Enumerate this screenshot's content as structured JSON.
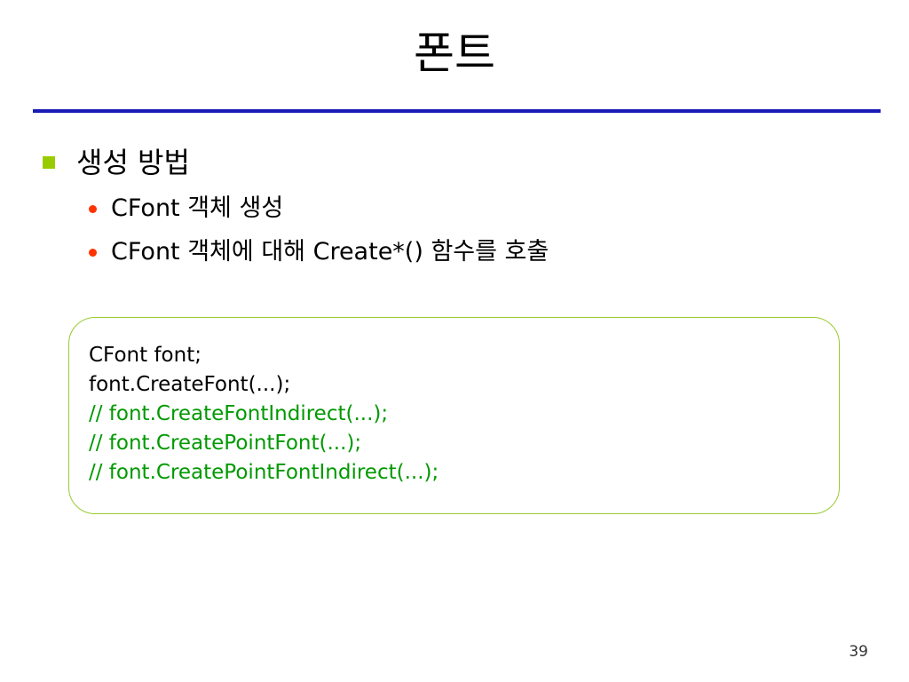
{
  "title": "폰트",
  "bullet_level1": {
    "text": "생성 방법"
  },
  "bullets_level2": [
    {
      "text": "CFont 객체 생성"
    },
    {
      "text": "CFont 객체에 대해 Create*() 함수를 호출"
    }
  ],
  "code_block": {
    "lines": [
      {
        "text": "CFont font;",
        "type": "code"
      },
      {
        "text": "font.CreateFont(...);",
        "type": "code"
      },
      {
        "text": "// font.CreateFontIndirect(...);",
        "type": "comment"
      },
      {
        "text": "// font.CreatePointFont(...);",
        "type": "comment"
      },
      {
        "text": "// font.CreatePointFontIndirect(...);",
        "type": "comment"
      }
    ]
  },
  "page_number": "39",
  "colors": {
    "title_rule": "#1a1ab4",
    "level1_marker": "#99cc00",
    "level2_marker": "#ff3300",
    "code_border": "#99cc33",
    "comment_text": "#009900"
  }
}
